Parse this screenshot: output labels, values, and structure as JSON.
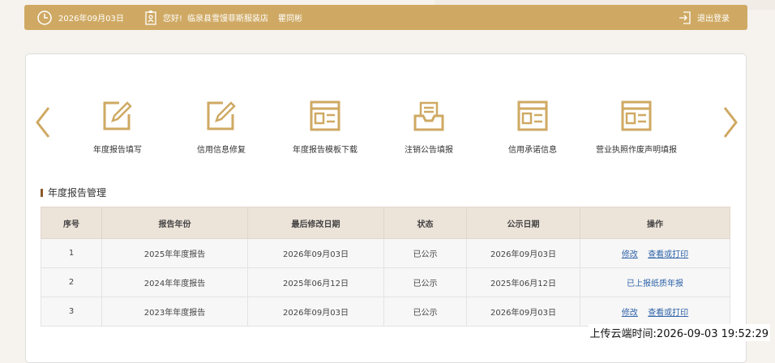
{
  "header": {
    "date": "2026年09月03日",
    "greeting": "您好!",
    "company": "临泉县雪馒菲斯服装店",
    "user": "瞿同彬",
    "logout": "退出登录"
  },
  "services": [
    {
      "label": "年度报告填写",
      "icon": "edit-document-icon"
    },
    {
      "label": "信用信息修复",
      "icon": "edit-document-icon"
    },
    {
      "label": "年度报告模板下载",
      "icon": "template-icon"
    },
    {
      "label": "注销公告填报",
      "icon": "tray-icon"
    },
    {
      "label": "信用承诺信息",
      "icon": "template-icon"
    },
    {
      "label": "营业执照作废声明填报",
      "icon": "template-icon"
    }
  ],
  "section": {
    "title": "年度报告管理"
  },
  "table": {
    "headers": [
      "序号",
      "报告年份",
      "最后修改日期",
      "状态",
      "公示日期",
      "操作"
    ],
    "rows": [
      {
        "no": "1",
        "year": "2025年年度报告",
        "modified": "2026年09月03日",
        "status": "已公示",
        "published": "2026年09月03日",
        "actions": [
          "修改",
          "查看或打印"
        ]
      },
      {
        "no": "2",
        "year": "2024年年度报告",
        "modified": "2025年06月12日",
        "status": "已公示",
        "published": "2025年06月12日",
        "actions_text": "已上报纸质年报"
      },
      {
        "no": "3",
        "year": "2023年年度报告",
        "modified": "2026年09月03日",
        "status": "已公示",
        "published": "2026年09月03日",
        "actions": [
          "修改",
          "查看或打印"
        ]
      }
    ]
  },
  "footer": {
    "upload_time": "上传云端时间:2026-09-03 19:52:29"
  },
  "colors": {
    "gold": "#cfa963",
    "header_bg": "#ece3d9",
    "link": "#2f63a8"
  }
}
